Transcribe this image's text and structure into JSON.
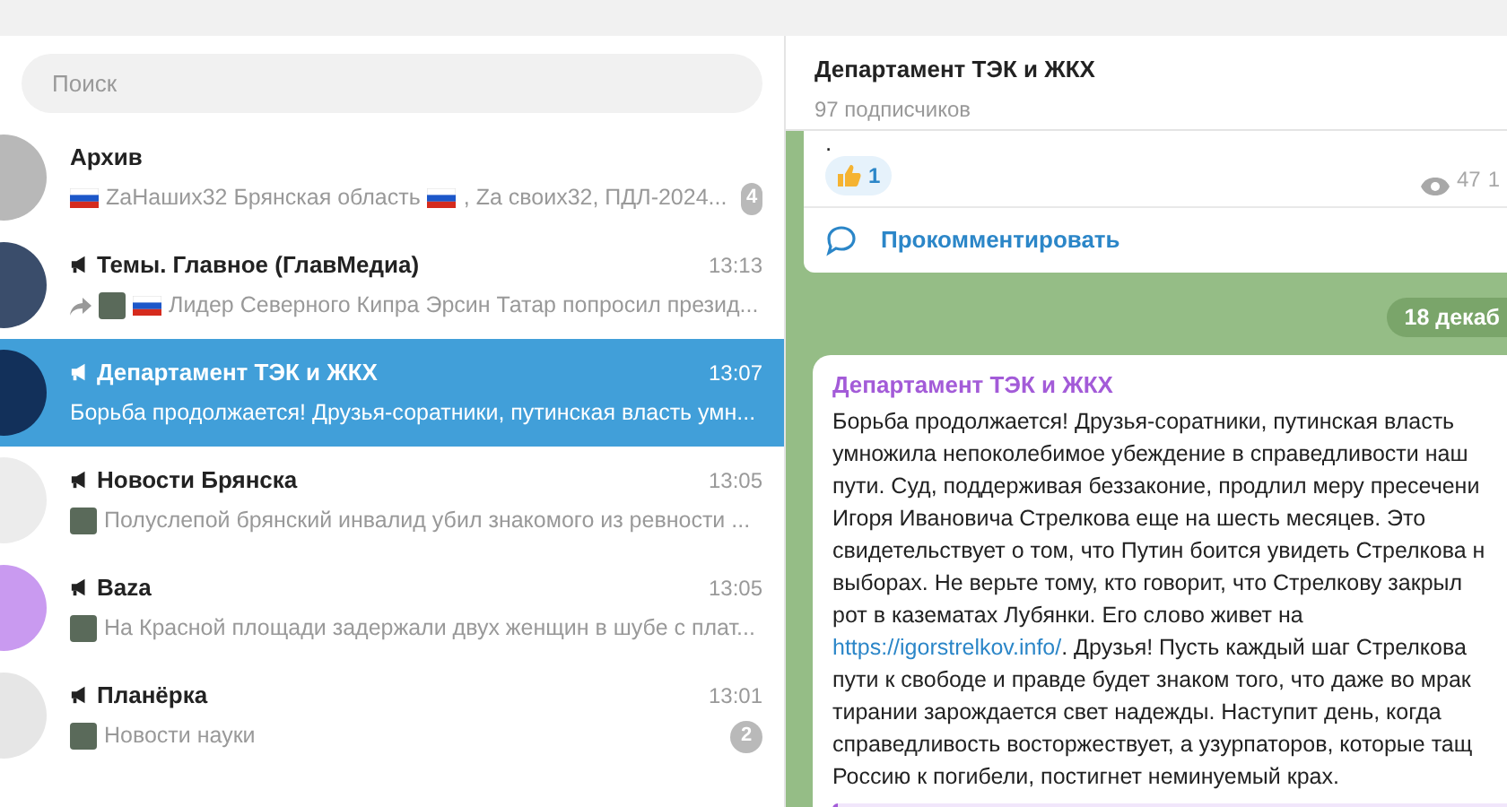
{
  "search": {
    "placeholder": "Поиск"
  },
  "chats": [
    {
      "name": "Архив",
      "channel": false,
      "selected": false,
      "color": "#b8b8b8",
      "badge": "4",
      "preview": [
        {
          "kind": "flag"
        },
        {
          "kind": "text",
          "text": "ZaНаших32 Брянская область"
        },
        {
          "kind": "flag"
        },
        {
          "kind": "text",
          "text": ", Za своих32, ПДЛ-2024..."
        }
      ]
    },
    {
      "name": "Темы. Главное (ГлавМедиа)",
      "channel": true,
      "selected": false,
      "color": "#3a4d6b",
      "time": "13:13",
      "preview": [
        {
          "kind": "forward"
        },
        {
          "kind": "thumb"
        },
        {
          "kind": "flag"
        },
        {
          "kind": "text",
          "text": "Лидер Северного Кипра Эрсин Татар попросил презид..."
        }
      ]
    },
    {
      "name": "Департамент ТЭК и ЖКХ",
      "channel": true,
      "selected": true,
      "color": "#12305a",
      "time": "13:07",
      "preview": [
        {
          "kind": "text",
          "text": "Борьба продолжается! Друзья-соратники, путинская власть умн..."
        }
      ]
    },
    {
      "name": "Новости Брянска",
      "channel": true,
      "selected": false,
      "color": "#ececec",
      "time": "13:05",
      "preview": [
        {
          "kind": "thumb"
        },
        {
          "kind": "text",
          "text": "Полуслепой брянский инвалид убил знакомого из ревности ..."
        }
      ]
    },
    {
      "name": "Baza",
      "channel": true,
      "selected": false,
      "color": "#c99af0",
      "time": "13:05",
      "preview": [
        {
          "kind": "thumb"
        },
        {
          "kind": "text",
          "text": "На Красной площади задержали двух женщин в шубе с плат..."
        }
      ]
    },
    {
      "name": "Планёрка",
      "channel": true,
      "selected": false,
      "color": "#e6e6e6",
      "time": "13:01",
      "badge": "2",
      "preview": [
        {
          "kind": "thumb"
        },
        {
          "kind": "text",
          "text": "Новости науки"
        }
      ]
    }
  ],
  "header": {
    "title": "Департамент ТЭК и ЖКХ",
    "subtitle": "97 подписчиков"
  },
  "post_1": {
    "text": ".",
    "reaction": {
      "count": "1"
    },
    "views": "47",
    "time": "1",
    "comment": "Прокомментировать"
  },
  "date_pill": "18 декаб",
  "post_2": {
    "author": "Департамент ТЭК и ЖКХ",
    "lines": [
      {
        "text": "Борьба продолжается! Друзья-соратники, путинская власть"
      },
      {
        "text": "умножила непоколебимое убеждение в справедливости наш"
      },
      {
        "text": "пути. Суд, поддерживая беззаконие, продлил меру пресечени"
      },
      {
        "text": "Игоря Ивановича Стрелкова еще на шесть месяцев. Это"
      },
      {
        "text": "свидетельствует о том, что Путин боится увидеть Стрелкова н"
      },
      {
        "text": "выборах. Не верьте тому, кто говорит, что Стрелкову закрыл"
      },
      {
        "text": "рот в казематах Лубянки. Его слово живет на"
      },
      {
        "link": "https://igorstrelkov.info/",
        "text": ". Друзья! Пусть каждый шаг Стрелкова"
      },
      {
        "text": "пути к свободе и правде будет знаком того, что даже во мрак"
      },
      {
        "text": "тирании зарождается свет надежды. Наступит день, когда"
      },
      {
        "text": "справедливость восторжествует, а узурпаторов, которые тащ"
      },
      {
        "text": "Россию к погибели, постигнет неминуемый крах."
      }
    ]
  }
}
